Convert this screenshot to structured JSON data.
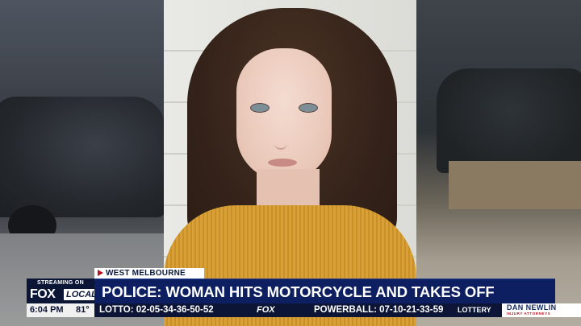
{
  "lower_third": {
    "location": "WEST MELBOURNE",
    "headline": "POLICE: WOMAN HITS MOTORCYCLE AND TAKES OFF"
  },
  "brand": {
    "streaming_label": "STREAMING ON",
    "fox": "FOX",
    "local": "LOCAL"
  },
  "ticker": {
    "time": "6:04 PM",
    "temperature": "81°",
    "lotto": "LOTTO:  02-05-34-36-50-52",
    "fox_logo": "FOX",
    "powerball": "POWERBALL:  07-10-21-33-59",
    "category": "LOTTERY"
  },
  "sponsor": {
    "name": "DAN NEWLIN",
    "subtitle": "INJURY ATTORNEYS"
  },
  "colors": {
    "headline_bg": "#0d1f60",
    "brand_bg": "#0b1636",
    "accent_red": "#b5121b"
  }
}
